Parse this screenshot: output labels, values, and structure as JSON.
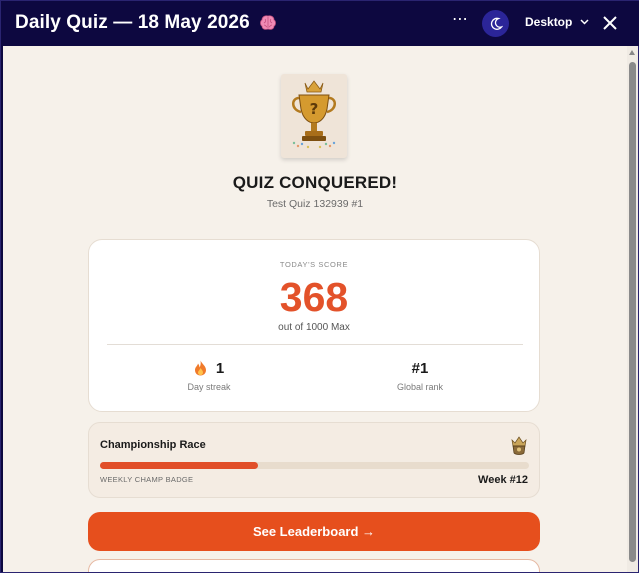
{
  "window": {
    "title": "Daily Quiz — 18 May 2026",
    "title_icon": "brain-icon",
    "more_label": "⋯",
    "theme_icon": "moon-icon",
    "device_label": "Desktop",
    "device_icon": "chevron-down-icon",
    "close_icon": "close-icon"
  },
  "result": {
    "image": "trophy-icon",
    "headline": "QUIZ CONQUERED!",
    "quiz_name": "Test Quiz 132939 #1"
  },
  "score": {
    "label": "TODAY'S SCORE",
    "value": "368",
    "max_text": "out of 1000 Max",
    "streak_value": "1",
    "streak_icon": "fire-icon",
    "streak_label": "Day streak",
    "rank_value": "#1",
    "rank_label": "Global rank"
  },
  "race": {
    "title": "Championship Race",
    "icon": "crown-badge-icon",
    "progress_fraction": 0.368,
    "badge_label": "WEEKLY CHAMP BADGE",
    "week_label": "Week #12"
  },
  "actions": {
    "leaderboard_label": "See Leaderboard →"
  },
  "colors": {
    "titlebar": "#0d0840",
    "accent": "#e64f1d",
    "score": "#e3522a",
    "background": "#f6f1ea"
  }
}
